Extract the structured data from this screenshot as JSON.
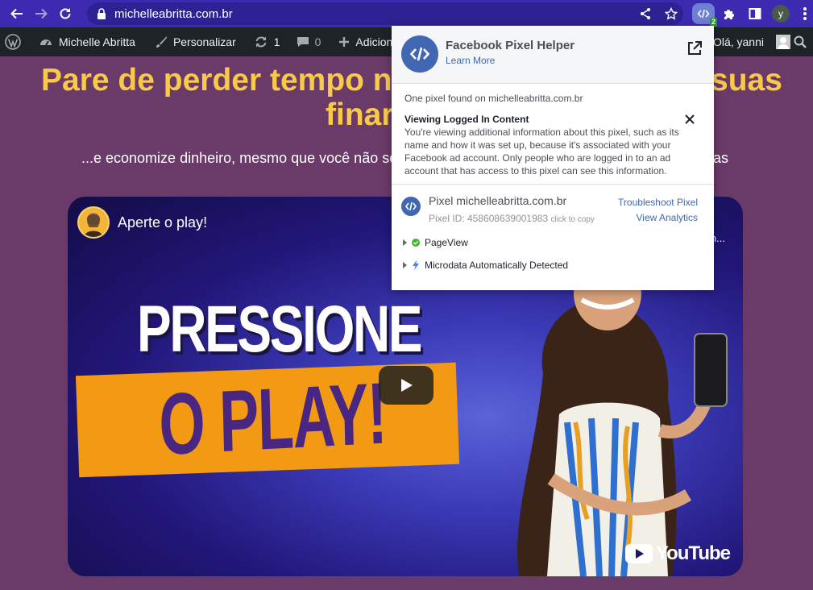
{
  "browser": {
    "url": "michelleabritta.com.br",
    "extension_badge": "2",
    "profile_initial": "y",
    "icons": [
      "back-arrow-icon",
      "forward-arrow-icon",
      "reload-icon",
      "lock-icon",
      "share-icon",
      "star-icon",
      "pixel-helper-extension-icon",
      "puzzle-icon",
      "sidebar-icon",
      "kebab-menu-icon"
    ]
  },
  "wp_admin_bar": {
    "site_name": "Michelle Abritta",
    "customize": "Personalizar",
    "updates_count": "1",
    "comments_count": "0",
    "add_new": "Adicionar",
    "greeting": "Olá, yanni"
  },
  "page": {
    "headline_left": "Pare de perder tempo n",
    "headline_right": "suas",
    "headline_line2": "finar",
    "subline_left": "...e economize dinheiro, mesmo que você não se",
    "subline_right": "as"
  },
  "video": {
    "title": "Aperte o play!",
    "more_text": "n...",
    "thumbnail_line1": "PRESSIONE",
    "thumbnail_line2": "O PLAY!",
    "platform": "YouTube"
  },
  "popup": {
    "title": "Facebook Pixel Helper",
    "learn_more": "Learn More",
    "found_text": "One pixel found on michelleabritta.com.br",
    "notice_title": "Viewing Logged In Content",
    "notice_body": "You're viewing additional information about this pixel, such as its name and how it was set up, because it's associated with your Facebook ad account. Only people who are logged in to an ad account that has access to this pixel can see this information.",
    "pixel_name": "Pixel michelleabritta.com.br",
    "pixel_id": "Pixel ID: 458608639001983",
    "click_to_copy": "click to copy",
    "troubleshoot": "Troubleshoot Pixel",
    "view_analytics": "View Analytics",
    "events": [
      {
        "label": "PageView",
        "icon": "check-circle-icon"
      },
      {
        "label": "Microdata Automatically Detected",
        "icon": "lightning-icon"
      }
    ]
  },
  "colors": {
    "browser_bar": "#3c2bb0",
    "page_background": "#6a3a68",
    "headline": "#f9c94a",
    "facebook_blue": "#4267b2",
    "thumbnail_orange": "#f29a13"
  }
}
